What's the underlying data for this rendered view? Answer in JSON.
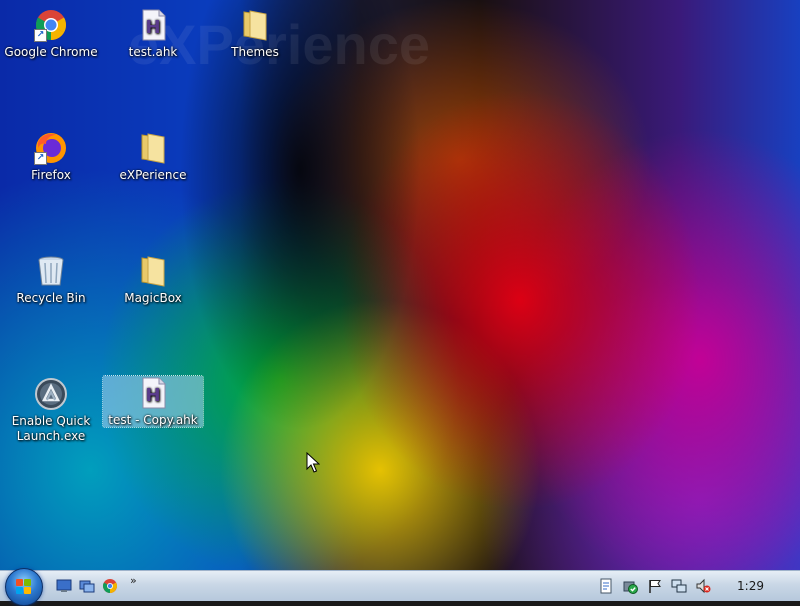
{
  "wallpaper": {
    "watermark": "eXPerience"
  },
  "desktop": {
    "icons": [
      {
        "label": "Google Chrome"
      },
      {
        "label": "test.ahk"
      },
      {
        "label": "Themes"
      },
      {
        "label": "Firefox"
      },
      {
        "label": "eXPerience"
      },
      {
        "label": "Recycle Bin"
      },
      {
        "label": "MagicBox"
      },
      {
        "label": "Enable Quick Launch.exe"
      },
      {
        "label": "test - Copy.ahk"
      }
    ]
  },
  "taskbar": {
    "chevron": "»",
    "clock": "1:29"
  }
}
